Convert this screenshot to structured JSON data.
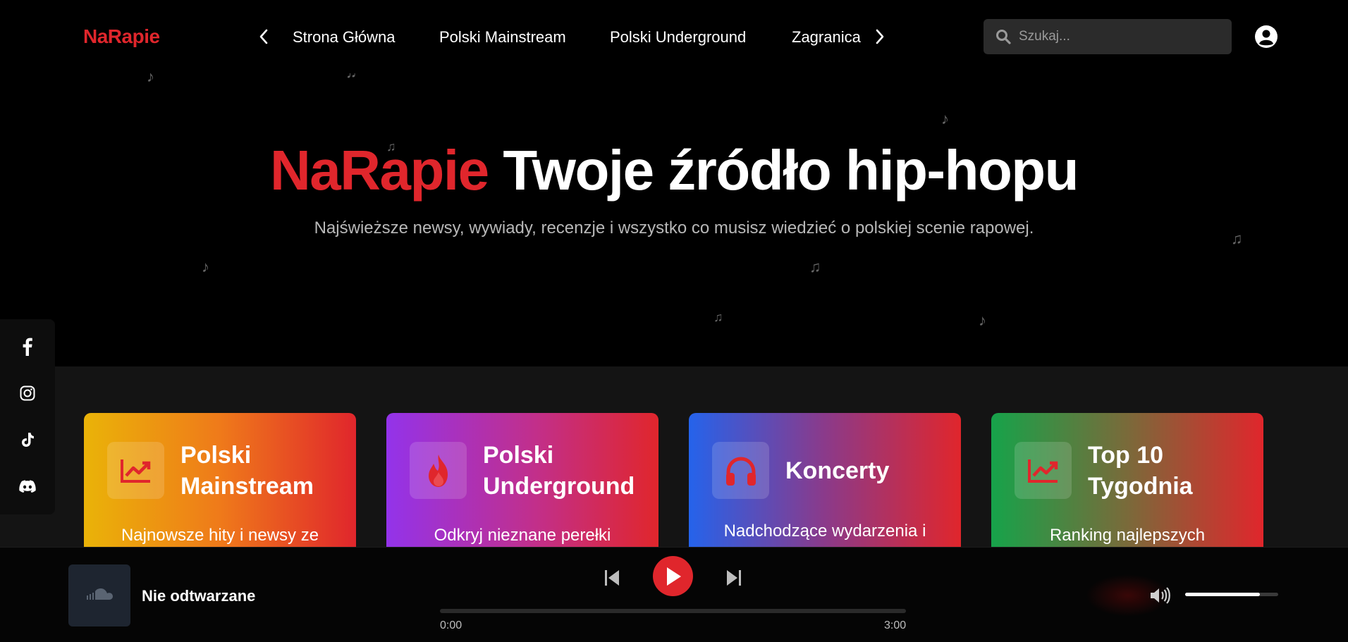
{
  "nav": {
    "logo": "NaRapie",
    "links": [
      "Strona Główna",
      "Polski Mainstream",
      "Polski Underground",
      "Zagranica"
    ],
    "search_placeholder": "Szukaj..."
  },
  "hero": {
    "title_brand": "NaRapie",
    "title_rest": "Twoje źródło hip-hopu",
    "subtitle": "Najświeższe newsy, wywiady, recenzje i wszystko co musisz wiedzieć o polskiej scenie rapowej."
  },
  "social": [
    "facebook-icon",
    "instagram-icon",
    "tiktok-icon",
    "discord-icon"
  ],
  "categories": [
    {
      "title": "Polski Mainstream",
      "desc": "Najnowsze hity i newsy ze",
      "icon": "trending-chart-icon"
    },
    {
      "title": "Polski Underground",
      "desc": "Odkryj nieznane perełki",
      "icon": "fire-icon"
    },
    {
      "title": "Koncerty",
      "desc": "Nadchodzące wydarzenia i",
      "icon": "headphones-icon"
    },
    {
      "title": "Top 10 Tygodnia",
      "desc": "Ranking najlepszych",
      "icon": "trending-chart-icon"
    }
  ],
  "player": {
    "status": "Nie odtwarzane",
    "current_time": "0:00",
    "duration": "3:00",
    "progress": 0,
    "volume": 0.8
  },
  "colors": {
    "accent": "#e0262c",
    "background": "#000000",
    "section": "#141414"
  }
}
